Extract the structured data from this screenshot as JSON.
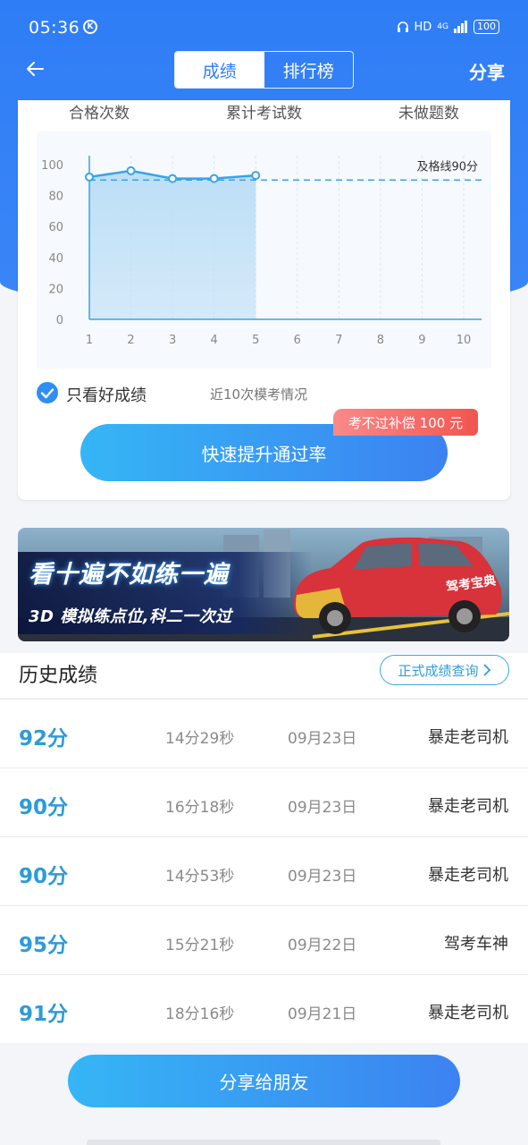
{
  "status_bar": {
    "time": "05:36",
    "k_badge": "K",
    "network": "HD",
    "signal": "4G",
    "battery": "100"
  },
  "nav": {
    "back_icon": "arrow-left-icon",
    "tabs": [
      {
        "label": "成绩",
        "active": true
      },
      {
        "label": "排行榜",
        "active": false
      }
    ],
    "share_label": "分享"
  },
  "summary": {
    "stats_labels": [
      "合格次数",
      "累计考试数",
      "未做题数"
    ]
  },
  "chart_data": {
    "type": "area",
    "x": [
      1,
      2,
      3,
      4,
      5,
      6,
      7,
      8,
      9,
      10
    ],
    "series": [
      {
        "values": [
          92,
          96,
          91,
          91,
          93
        ]
      }
    ],
    "y_ticks": [
      0,
      20,
      40,
      60,
      80,
      100
    ],
    "ylim": [
      0,
      100
    ],
    "xlim": [
      1,
      10
    ],
    "pass_line": {
      "value": 90,
      "label": "及格线90分"
    },
    "grid": true,
    "colors": {
      "line": "#3aa3e8",
      "fill": "#b9ddf6",
      "pass_line": "#3aa3e8"
    }
  },
  "filter": {
    "checked": true,
    "check_label": "只看好成绩",
    "recent_label": "近10次模考情况"
  },
  "cta": {
    "label": "快速提升通过率",
    "promo_badge": "考不过补偿 100 元"
  },
  "banner": {
    "line1": "看十遍不如练一遍",
    "line2": "3D 模拟练点位,科二一次过",
    "car_text": "驾考宝典"
  },
  "history": {
    "title": "历史成绩",
    "link_label": "正式成绩查询",
    "rows": [
      {
        "score": "92分",
        "duration": "14分29秒",
        "date": "09月23日",
        "name": "暴走老司机"
      },
      {
        "score": "90分",
        "duration": "16分18秒",
        "date": "09月23日",
        "name": "暴走老司机"
      },
      {
        "score": "90分",
        "duration": "14分53秒",
        "date": "09月23日",
        "name": "暴走老司机"
      },
      {
        "score": "95分",
        "duration": "15分21秒",
        "date": "09月22日",
        "name": "驾考车神"
      },
      {
        "score": "91分",
        "duration": "18分16秒",
        "date": "09月21日",
        "name": "暴走老司机"
      }
    ]
  },
  "share_button": {
    "label": "分享给朋友"
  }
}
